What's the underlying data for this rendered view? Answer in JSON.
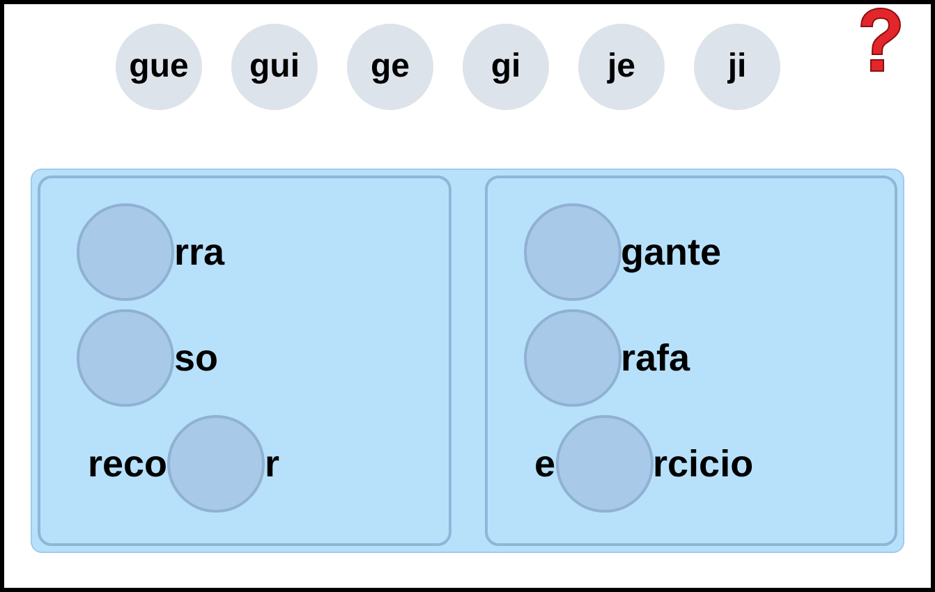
{
  "syllables": [
    "gue",
    "gui",
    "ge",
    "gi",
    "je",
    "ji"
  ],
  "columns": [
    {
      "words": [
        {
          "parts": [
            {
              "kind": "blank"
            },
            {
              "kind": "text",
              "text": "rra"
            }
          ]
        },
        {
          "parts": [
            {
              "kind": "blank"
            },
            {
              "kind": "text",
              "text": "so"
            }
          ]
        },
        {
          "parts": [
            {
              "kind": "text",
              "text": "reco"
            },
            {
              "kind": "blank"
            },
            {
              "kind": "text",
              "text": "r"
            }
          ]
        }
      ]
    },
    {
      "words": [
        {
          "parts": [
            {
              "kind": "blank"
            },
            {
              "kind": "text",
              "text": "gante"
            }
          ]
        },
        {
          "parts": [
            {
              "kind": "blank"
            },
            {
              "kind": "text",
              "text": "rafa"
            }
          ]
        },
        {
          "parts": [
            {
              "kind": "text",
              "text": "e"
            },
            {
              "kind": "blank"
            },
            {
              "kind": "text",
              "text": "rcicio"
            }
          ]
        }
      ]
    }
  ]
}
